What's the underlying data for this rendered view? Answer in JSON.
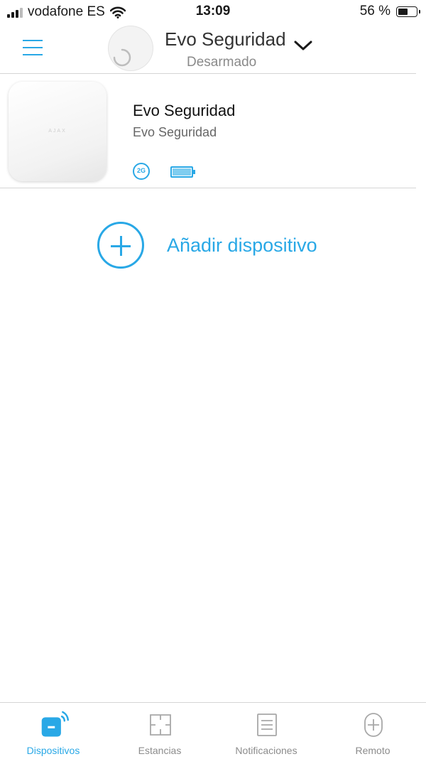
{
  "status_bar": {
    "carrier": "vodafone ES",
    "time": "13:09",
    "battery_percent": "56 %",
    "battery_level": 0.56
  },
  "header": {
    "hub_name": "Evo Seguridad",
    "hub_state": "Desarmado"
  },
  "devices": [
    {
      "name": "Evo Seguridad",
      "room": "Evo Seguridad",
      "brand_mark": "AJAX",
      "network_badge": "2G",
      "battery_level": 1.0
    }
  ],
  "add_device": {
    "label": "Añadir dispositivo"
  },
  "tabs": [
    {
      "label": "Dispositivos",
      "icon": "devices-icon",
      "active": true
    },
    {
      "label": "Estancias",
      "icon": "rooms-icon",
      "active": false
    },
    {
      "label": "Notificaciones",
      "icon": "notifications-icon",
      "active": false
    },
    {
      "label": "Remoto",
      "icon": "remote-icon",
      "active": false
    }
  ],
  "colors": {
    "accent": "#29a8e6",
    "inactive": "#8c8c8c"
  }
}
